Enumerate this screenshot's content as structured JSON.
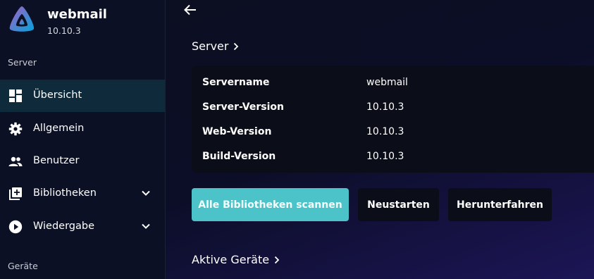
{
  "brand": {
    "name": "webmail",
    "version": "10.10.3"
  },
  "sidebar": {
    "section_server": "Server",
    "section_devices": "Geräte",
    "items": [
      {
        "label": "Übersicht",
        "icon": "dashboard-icon",
        "active": true
      },
      {
        "label": "Allgemein",
        "icon": "gear-icon"
      },
      {
        "label": "Benutzer",
        "icon": "users-icon"
      },
      {
        "label": "Bibliotheken",
        "icon": "library-add-icon",
        "expandable": true
      },
      {
        "label": "Wiedergabe",
        "icon": "play-circle-icon",
        "expandable": true
      }
    ]
  },
  "main": {
    "server_heading": "Server",
    "info": [
      {
        "key": "Servername",
        "value": "webmail"
      },
      {
        "key": "Server-Version",
        "value": "10.10.3"
      },
      {
        "key": "Web-Version",
        "value": "10.10.3"
      },
      {
        "key": "Build-Version",
        "value": "10.10.3"
      }
    ],
    "buttons": {
      "scan": "Alle Bibliotheken scannen",
      "restart": "Neustarten",
      "shutdown": "Herunterfahren"
    },
    "devices_heading": "Aktive Geräte"
  },
  "colors": {
    "accent": "#4cc3c9",
    "sidebar_bg": "#0b1025",
    "active_item_bg": "#0f2a3b",
    "card_bg": "#0b0d18"
  }
}
